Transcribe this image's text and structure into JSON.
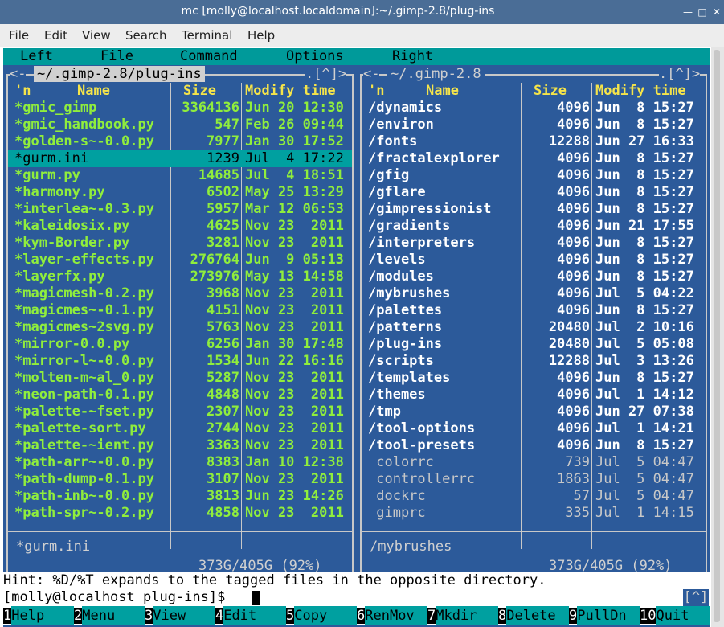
{
  "window": {
    "title": "mc [molly@localhost.localdomain]:~/.gimp-2.8/plug-ins",
    "min_label": "—",
    "max_label": "□",
    "close_label": "✕"
  },
  "menubar": [
    "File",
    "Edit",
    "View",
    "Search",
    "Terminal",
    "Help"
  ],
  "mc_menu": [
    "Left",
    "File",
    "Command",
    "Options",
    "Right"
  ],
  "left_panel": {
    "path": "~/.gimp-2.8/plug-ins",
    "corner_left": "<-",
    "corner_right": ".[^]>",
    "headers": {
      "n": "'n",
      "name": "Name",
      "size": "Size",
      "modify": "Modify time"
    },
    "rows": [
      [
        "*gmic_gimp",
        "3364136",
        "Jun 20 12:30"
      ],
      [
        "*gmic_handbook.py",
        "547",
        "Feb 26 09:44"
      ],
      [
        "*golden-s~-0.0.py",
        "7977",
        "Jan 30 17:52"
      ],
      [
        "*gurm.ini",
        "1239",
        "Jul  4 17:22"
      ],
      [
        "*gurm.py",
        "14685",
        "Jul  4 18:51"
      ],
      [
        "*harmony.py",
        "6502",
        "May 25 13:29"
      ],
      [
        "*interlea~-0.3.py",
        "5957",
        "Mar 12 06:53"
      ],
      [
        "*kaleidosix.py",
        "4625",
        "Nov 23  2011"
      ],
      [
        "*kym-Border.py",
        "3281",
        "Nov 23  2011"
      ],
      [
        "*layer-effects.py",
        "276764",
        "Jun  9 05:13"
      ],
      [
        "*layerfx.py",
        "273976",
        "May 13 14:58"
      ],
      [
        "*magicmesh-0.2.py",
        "3968",
        "Nov 23  2011"
      ],
      [
        "*magicmes~-0.1.py",
        "4151",
        "Nov 23  2011"
      ],
      [
        "*magicmes~2svg.py",
        "5763",
        "Nov 23  2011"
      ],
      [
        "*mirror-0.0.py",
        "6256",
        "Jan 30 17:48"
      ],
      [
        "*mirror-l~-0.0.py",
        "1534",
        "Jun 22 16:16"
      ],
      [
        "*molten-m~al_0.py",
        "5287",
        "Nov 23  2011"
      ],
      [
        "*neon-path-0.1.py",
        "4848",
        "Nov 23  2011"
      ],
      [
        "*palette-~fset.py",
        "2307",
        "Nov 23  2011"
      ],
      [
        "*palette-sort.py",
        "2744",
        "Nov 23  2011"
      ],
      [
        "*palette-~ient.py",
        "3363",
        "Nov 23  2011"
      ],
      [
        "*path-arr~-0.0.py",
        "8383",
        "Jan 10 12:38"
      ],
      [
        "*path-dump-0.1.py",
        "3107",
        "Nov 23  2011"
      ],
      [
        "*path-inb~-0.0.py",
        "3813",
        "Jun 23 14:26"
      ],
      [
        "*path-spr~-0.2.py",
        "4858",
        "Nov 23  2011"
      ]
    ],
    "selected_index": 3,
    "mini_status": "*gurm.ini",
    "disk": "373G/405G (92%)"
  },
  "right_panel": {
    "path": "~/.gimp-2.8",
    "corner_left": "<-",
    "corner_right": ".[^]>",
    "headers": {
      "n": "'n",
      "name": "Name",
      "size": "Size",
      "modify": "Modify time"
    },
    "rows": [
      [
        "/dynamics",
        "4096",
        "Jun  8 15:27",
        "dir"
      ],
      [
        "/environ",
        "4096",
        "Jun  8 15:27",
        "dir"
      ],
      [
        "/fonts",
        "12288",
        "Jun 27 16:33",
        "dir"
      ],
      [
        "/fractalexplorer",
        "4096",
        "Jun  8 15:27",
        "dir"
      ],
      [
        "/gfig",
        "4096",
        "Jun  8 15:27",
        "dir"
      ],
      [
        "/gflare",
        "4096",
        "Jun  8 15:27",
        "dir"
      ],
      [
        "/gimpressionist",
        "4096",
        "Jun  8 15:27",
        "dir"
      ],
      [
        "/gradients",
        "4096",
        "Jun 21 17:55",
        "dir"
      ],
      [
        "/interpreters",
        "4096",
        "Jun  8 15:27",
        "dir"
      ],
      [
        "/levels",
        "4096",
        "Jun  8 15:27",
        "dir"
      ],
      [
        "/modules",
        "4096",
        "Jun  8 15:27",
        "dir"
      ],
      [
        "/mybrushes",
        "4096",
        "Jul  5 04:22",
        "dir"
      ],
      [
        "/palettes",
        "4096",
        "Jun  8 15:27",
        "dir"
      ],
      [
        "/patterns",
        "20480",
        "Jul  2 10:16",
        "dir"
      ],
      [
        "/plug-ins",
        "20480",
        "Jul  5 05:08",
        "dir"
      ],
      [
        "/scripts",
        "12288",
        "Jul  3 13:26",
        "dir"
      ],
      [
        "/templates",
        "4096",
        "Jun  8 15:27",
        "dir"
      ],
      [
        "/themes",
        "4096",
        "Jul  1 14:12",
        "dir"
      ],
      [
        "/tmp",
        "4096",
        "Jun 27 07:38",
        "dir"
      ],
      [
        "/tool-options",
        "4096",
        "Jul  1 14:21",
        "dir"
      ],
      [
        "/tool-presets",
        "4096",
        "Jun  8 15:27",
        "dir"
      ],
      [
        " colorrc",
        "739",
        "Jul  5 04:47",
        "file"
      ],
      [
        " controllerrc",
        "1863",
        "Jul  5 04:47",
        "file"
      ],
      [
        " dockrc",
        "57",
        "Jul  5 04:47",
        "file"
      ],
      [
        " gimprc",
        "335",
        "Jul  1 14:15",
        "file"
      ]
    ],
    "mini_status": "/mybrushes",
    "disk": "373G/405G (92%)"
  },
  "hint": "Hint: %D/%T expands to the tagged files in the opposite directory.",
  "prompt": "[molly@localhost plug-ins]$ ",
  "prompt_tag": "[^]",
  "fkeys": [
    {
      "n": "1",
      "label": "Help"
    },
    {
      "n": "2",
      "label": "Menu"
    },
    {
      "n": "3",
      "label": "View"
    },
    {
      "n": "4",
      "label": "Edit"
    },
    {
      "n": "5",
      "label": "Copy"
    },
    {
      "n": "6",
      "label": "RenMov"
    },
    {
      "n": "7",
      "label": "Mkdir"
    },
    {
      "n": "8",
      "label": "Delete"
    },
    {
      "n": "9",
      "label": "PullDn"
    },
    {
      "n": "10",
      "label": "Quit"
    }
  ],
  "colors": {
    "panel_bg": "#2c5a9a",
    "exec_file": "#90ee3c",
    "dir": "#ffffff",
    "plain_file": "#c8c8c8",
    "header": "#f5e44a",
    "selection": "#00a0a0"
  }
}
